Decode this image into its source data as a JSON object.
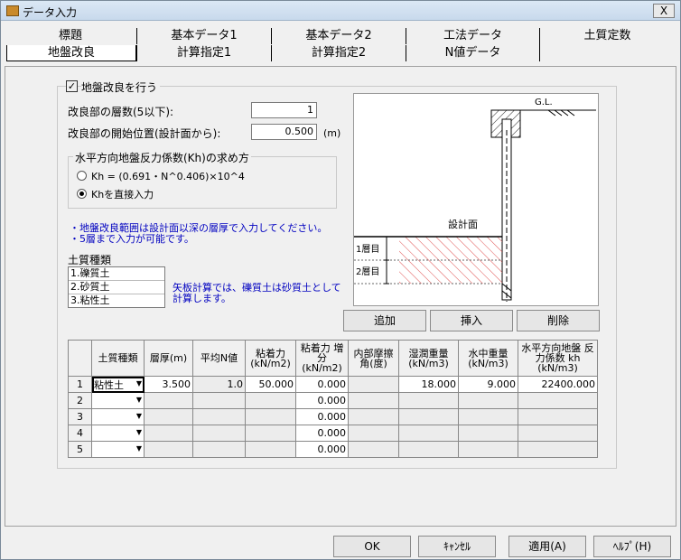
{
  "window": {
    "title": "データ入力",
    "close_label": "X"
  },
  "tabs": {
    "row1": [
      "標題",
      "基本データ1",
      "基本データ2",
      "工法データ",
      "土質定数"
    ],
    "row2": [
      "地盤改良",
      "計算指定1",
      "計算指定2",
      "N値データ"
    ]
  },
  "ground": {
    "enable_label": "地盤改良を行う",
    "enable_checked": true,
    "layers_label": "改良部の層数(5以下):",
    "layers_value": "1",
    "start_label": "改良部の開始位置(設計面から):",
    "start_value": "0.500",
    "start_unit": "(m)"
  },
  "kh_group": {
    "title": "水平方向地盤反力係数(Kh)の求め方",
    "option1": "Kh = (0.691・N^0.406)×10^4",
    "option2": "Khを直接入力",
    "selected": 2
  },
  "notes": {
    "line1": "・地盤改良範囲は設計面以深の層厚で入力してください。",
    "line2": "・5層まで入力が可能です。",
    "soil_note_line1": "矢板計算では、礫質土は砂質土として",
    "soil_note_line2": "計算します。"
  },
  "soil_types": {
    "label": "土質種類",
    "items": [
      "1.礫質土",
      "2.砂質土",
      "3.粘性土"
    ]
  },
  "diagram": {
    "gl_label": "G.L.",
    "design_label": "設計面",
    "layer1_label": "1層目",
    "layer2_label": "2層目"
  },
  "layer_buttons": {
    "add": "追加",
    "insert": "挿入",
    "delete": "削除"
  },
  "grid": {
    "headers": [
      "土質種類",
      "層厚(m)",
      "平均N値",
      "粘着力 (kN/m2)",
      "粘着力 増分 (kN/m2)",
      "内部摩擦 角(度)",
      "湿潤重量 (kN/m3)",
      "水中重量 (kN/m3)",
      "水平方向地盤 反力係数 kh (kN/m3)"
    ],
    "rows": [
      {
        "no": "1",
        "soil": "粘性土",
        "thickness": "3.500",
        "avg_n": "1.0",
        "cohesion": "50.000",
        "cohesion_inc": "0.000",
        "friction": "",
        "wet_weight": "18.000",
        "sub_weight": "9.000",
        "kh": "22400.000"
      },
      {
        "no": "2",
        "soil": "",
        "thickness": "",
        "avg_n": "",
        "cohesion": "",
        "cohesion_inc": "0.000",
        "friction": "",
        "wet_weight": "",
        "sub_weight": "",
        "kh": ""
      },
      {
        "no": "3",
        "soil": "",
        "thickness": "",
        "avg_n": "",
        "cohesion": "",
        "cohesion_inc": "0.000",
        "friction": "",
        "wet_weight": "",
        "sub_weight": "",
        "kh": ""
      },
      {
        "no": "4",
        "soil": "",
        "thickness": "",
        "avg_n": "",
        "cohesion": "",
        "cohesion_inc": "0.000",
        "friction": "",
        "wet_weight": "",
        "sub_weight": "",
        "kh": ""
      },
      {
        "no": "5",
        "soil": "",
        "thickness": "",
        "avg_n": "",
        "cohesion": "",
        "cohesion_inc": "0.000",
        "friction": "",
        "wet_weight": "",
        "sub_weight": "",
        "kh": ""
      }
    ]
  },
  "footer": {
    "ok": "OK",
    "cancel": "ｷｬﾝｾﾙ",
    "apply": "適用(A)",
    "help": "ﾍﾙﾌﾟ(H)"
  },
  "colors": {
    "hatch": "#e05050",
    "note": "#0000c0"
  }
}
